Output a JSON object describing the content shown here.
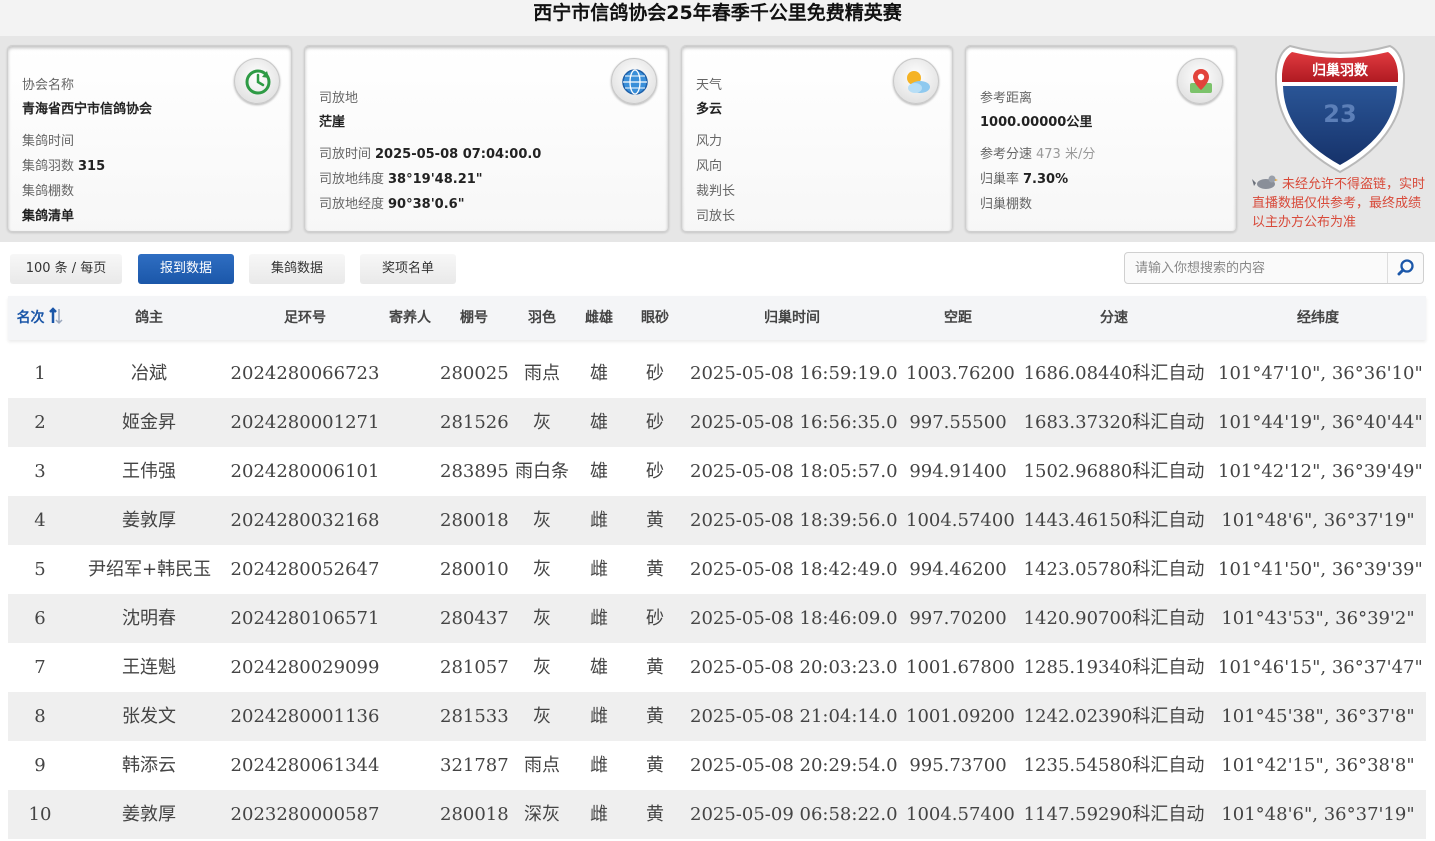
{
  "page_title": "西宁市信鸽协会25年春季千公里免费精英赛",
  "cards": {
    "association": {
      "name_label": "协会名称",
      "name_value": "青海省西宁市信鸽协会",
      "collect_time_label": "集鸽时间",
      "collect_count_label": "集鸽羽数",
      "collect_count_value": "315",
      "collect_lofts_label": "集鸽棚数",
      "collect_list_label": "集鸽清单"
    },
    "release": {
      "site_label": "司放地",
      "site_value": "茫崖",
      "time_label": "司放时间",
      "time_value": "2025-05-08 07:04:00.0",
      "lat_label": "司放地纬度",
      "lat_value": "38°19'48.21\"",
      "lon_label": "司放地经度",
      "lon_value": "90°38'0.6\""
    },
    "weather": {
      "weather_label": "天气",
      "weather_value": "多云",
      "wind_force_label": "风力",
      "wind_dir_label": "风向",
      "referee_label": "裁判长",
      "releaser_label": "司放长"
    },
    "distance": {
      "ref_dist_label": "参考距离",
      "ref_dist_value": "1000.00000公里",
      "ref_speed_label": "参考分速",
      "ref_speed_value": "473 米/分",
      "return_rate_label": "归巢率",
      "return_rate_value": "7.30%",
      "return_lofts_label": "归巢棚数"
    }
  },
  "badge": {
    "label": "归巢羽数",
    "value": "23",
    "color_red": "#c8212b",
    "color_blue": "#1d3f7a"
  },
  "notice": "未经允许不得盗链，实时直播数据仅供参考，最终成绩以主办方公布为准",
  "toolbar": {
    "page_size": "100 条 / 每页",
    "tabs": [
      "报到数据",
      "集鸽数据",
      "奖项名单"
    ],
    "search_placeholder": "请输入你想搜索的内容"
  },
  "table": {
    "headers": [
      "名次",
      "鸽主",
      "足环号",
      "寄养人",
      "棚号",
      "羽色",
      "雌雄",
      "眼砂",
      "归巢时间",
      "空距",
      "分速",
      "经纬度"
    ],
    "rows": [
      [
        "1",
        "冶斌",
        "2024280066723",
        "",
        "280025",
        "雨点",
        "雄",
        "砂",
        "2025-05-08 16:59:19.0",
        "1003.76200",
        "1686.08440科汇自动",
        "101°47'10\", 36°36'10\""
      ],
      [
        "2",
        "姬金昇",
        "2024280001271",
        "",
        "281526",
        "灰",
        "雄",
        "砂",
        "2025-05-08 16:56:35.0",
        "997.55500",
        "1683.37320科汇自动",
        "101°44'19\", 36°40'44\""
      ],
      [
        "3",
        "王伟强",
        "2024280006101",
        "",
        "283895",
        "雨白条",
        "雄",
        "砂",
        "2025-05-08 18:05:57.0",
        "994.91400",
        "1502.96880科汇自动",
        "101°42'12\", 36°39'49\""
      ],
      [
        "4",
        "姜敦厚",
        "2024280032168",
        "",
        "280018",
        "灰",
        "雌",
        "黄",
        "2025-05-08 18:39:56.0",
        "1004.57400",
        "1443.46150科汇自动",
        "101°48'6\", 36°37'19\""
      ],
      [
        "5",
        "尹绍军+韩民玉",
        "2024280052647",
        "",
        "280010",
        "灰",
        "雌",
        "黄",
        "2025-05-08 18:42:49.0",
        "994.46200",
        "1423.05780科汇自动",
        "101°41'50\", 36°39'39\""
      ],
      [
        "6",
        "沈明春",
        "2024280106571",
        "",
        "280437",
        "灰",
        "雌",
        "砂",
        "2025-05-08 18:46:09.0",
        "997.70200",
        "1420.90700科汇自动",
        "101°43'53\", 36°39'2\""
      ],
      [
        "7",
        "王连魁",
        "2024280029099",
        "",
        "281057",
        "灰",
        "雄",
        "黄",
        "2025-05-08 20:03:23.0",
        "1001.67800",
        "1285.19340科汇自动",
        "101°46'15\", 36°37'47\""
      ],
      [
        "8",
        "张发文",
        "2024280001136",
        "",
        "281533",
        "灰",
        "雌",
        "黄",
        "2025-05-08 21:04:14.0",
        "1001.09200",
        "1242.02390科汇自动",
        "101°45'38\", 36°37'8\""
      ],
      [
        "9",
        "韩添云",
        "2024280061344",
        "",
        "321787",
        "雨点",
        "雌",
        "黄",
        "2025-05-08 20:29:54.0",
        "995.73700",
        "1235.54580科汇自动",
        "101°42'15\", 36°38'8\""
      ],
      [
        "10",
        "姜敦厚",
        "2023280000587",
        "",
        "280018",
        "深灰",
        "雌",
        "黄",
        "2025-05-09 06:58:22.0",
        "1004.57400",
        "1147.59290科汇自动",
        "101°48'6\", 36°37'19\""
      ]
    ]
  }
}
